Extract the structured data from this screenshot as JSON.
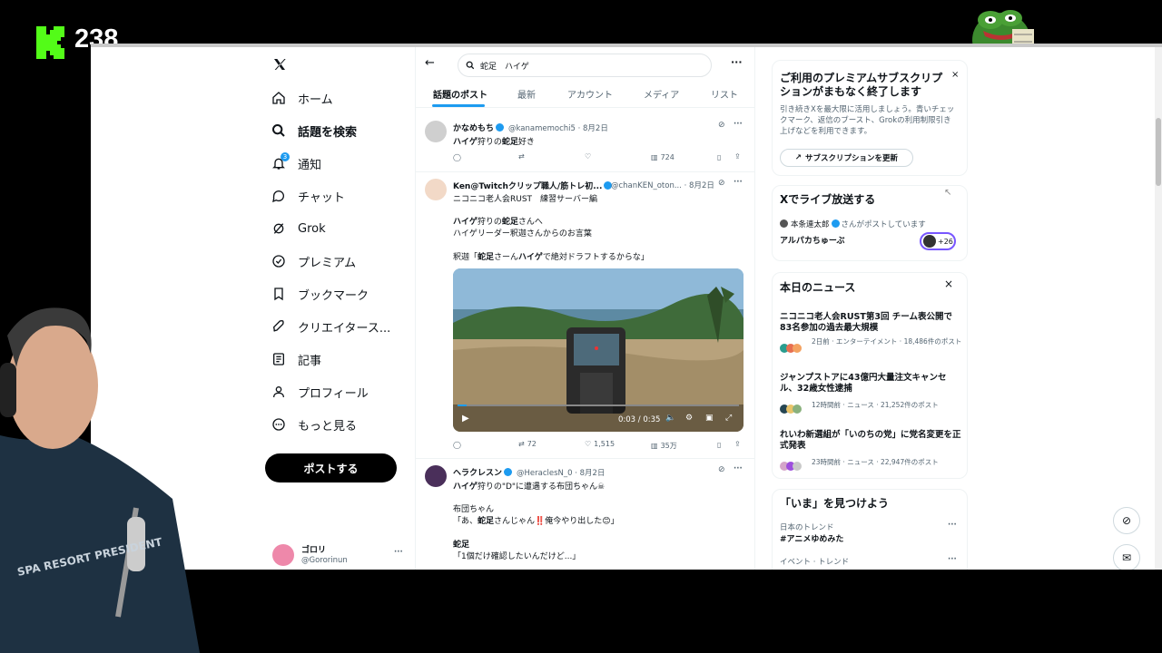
{
  "overlay": {
    "viewer_count": "238"
  },
  "nav": {
    "items": [
      {
        "label": "ホーム",
        "icon": "home-icon"
      },
      {
        "label": "話題を検索",
        "icon": "search-icon"
      },
      {
        "label": "通知",
        "icon": "bell-icon",
        "badge": "3"
      },
      {
        "label": "チャット",
        "icon": "chat-icon"
      },
      {
        "label": "Grok",
        "icon": "grok-icon"
      },
      {
        "label": "プレミアム",
        "icon": "premium-icon"
      },
      {
        "label": "ブックマーク",
        "icon": "bookmark-icon"
      },
      {
        "label": "クリエイタース...",
        "icon": "rocket-icon"
      },
      {
        "label": "記事",
        "icon": "article-icon"
      },
      {
        "label": "プロフィール",
        "icon": "person-icon"
      },
      {
        "label": "もっと見る",
        "icon": "more-icon"
      }
    ],
    "post_button": "ポストする",
    "account": {
      "name": "ゴロリ",
      "handle": "@Gororinun"
    }
  },
  "search": {
    "query": "蛇足　ハイゲ"
  },
  "tabs": [
    "話題のポスト",
    "最新",
    "アカウント",
    "メディア",
    "リスト"
  ],
  "tweets": [
    {
      "name": "かなめもち",
      "handle": "@kanamemochi5 · 8月2日",
      "text_bold": "ハイゲ",
      "text_mid": "狩りの",
      "text_bold2": "蛇足",
      "text_end": "好き",
      "views": "724"
    },
    {
      "name": "Ken@Twitchクリップ職人/筋トレ初...",
      "handle": "@chanKEN_oton... · 8月2日",
      "line1": "ニコニコ老人会RUST　練習サーバー編",
      "line2_a": "ハイゲ",
      "line2_b": "狩りの",
      "line2_c": "蛇足",
      "line2_d": "さんへ",
      "line3": "ハイゲリーダー釈迦さんからのお言葉",
      "line4_a": "釈迦「",
      "line4_b": "蛇足",
      "line4_c": "さーん",
      "line4_d": "ハイゲ",
      "line4_e": "で絶対ドラフトするからな」",
      "video_time": "0:03 / 0:35",
      "retweets": "72",
      "likes": "1,515",
      "views": "35万"
    },
    {
      "name": "ヘラクレスン",
      "handle": "@HeraclesN_0 · 8月2日",
      "line1_a": "ハイゲ",
      "line1_b": "狩りの\"D\"に遭遇する布団ちゃん☠",
      "line2": "布団ちゃん",
      "line3_a": "「あ、",
      "line3_b": "蛇足",
      "line3_c": "さんじゃん‼️俺今やり出した😊」",
      "line4": "蛇足",
      "line5": "「1個だけ確認したいんだけど...」"
    }
  ],
  "premium_card": {
    "title": "ご利用のプレミアムサブスクリプションがまもなく終了します",
    "body": "引き続きXを最大限に活用しましょう。青いチェックマーク、返信のブースト、Grokの利用制限引き上げなどを利用できます。",
    "button": "サブスクリプションを更新"
  },
  "live_card": {
    "title": "Xでライブ放送する",
    "host": "本条連太郎",
    "host_suffix": "さんがポストしています",
    "stream_title": "アルパカちゅーぶ",
    "count": "+26"
  },
  "news_card": {
    "title": "本日のニュース",
    "items": [
      {
        "headline": "ニコニコ老人会RUST第3回 チーム表公開で83名参加の過去最大規模",
        "meta": "2日前 · エンターテイメント · 18,486件のポスト"
      },
      {
        "headline": "ジャンプストアに43億円大量注文キャンセル、32歳女性逮捕",
        "meta": "12時間前 · ニュース · 21,252件のポスト"
      },
      {
        "headline": "れいわ新選組が「いのちの党」に党名変更を正式発表",
        "meta": "23時間前 · ニュース · 22,947件のポスト"
      }
    ]
  },
  "trends_card": {
    "title": "「いま」を見つけよう",
    "items": [
      {
        "category": "日本のトレンド",
        "topic": "#アニメゆめみた"
      },
      {
        "category": "イベント · トレンド",
        "topic": ""
      }
    ]
  },
  "webcam": {
    "shirt_text": "SPA RESORT PRESIDENT"
  }
}
